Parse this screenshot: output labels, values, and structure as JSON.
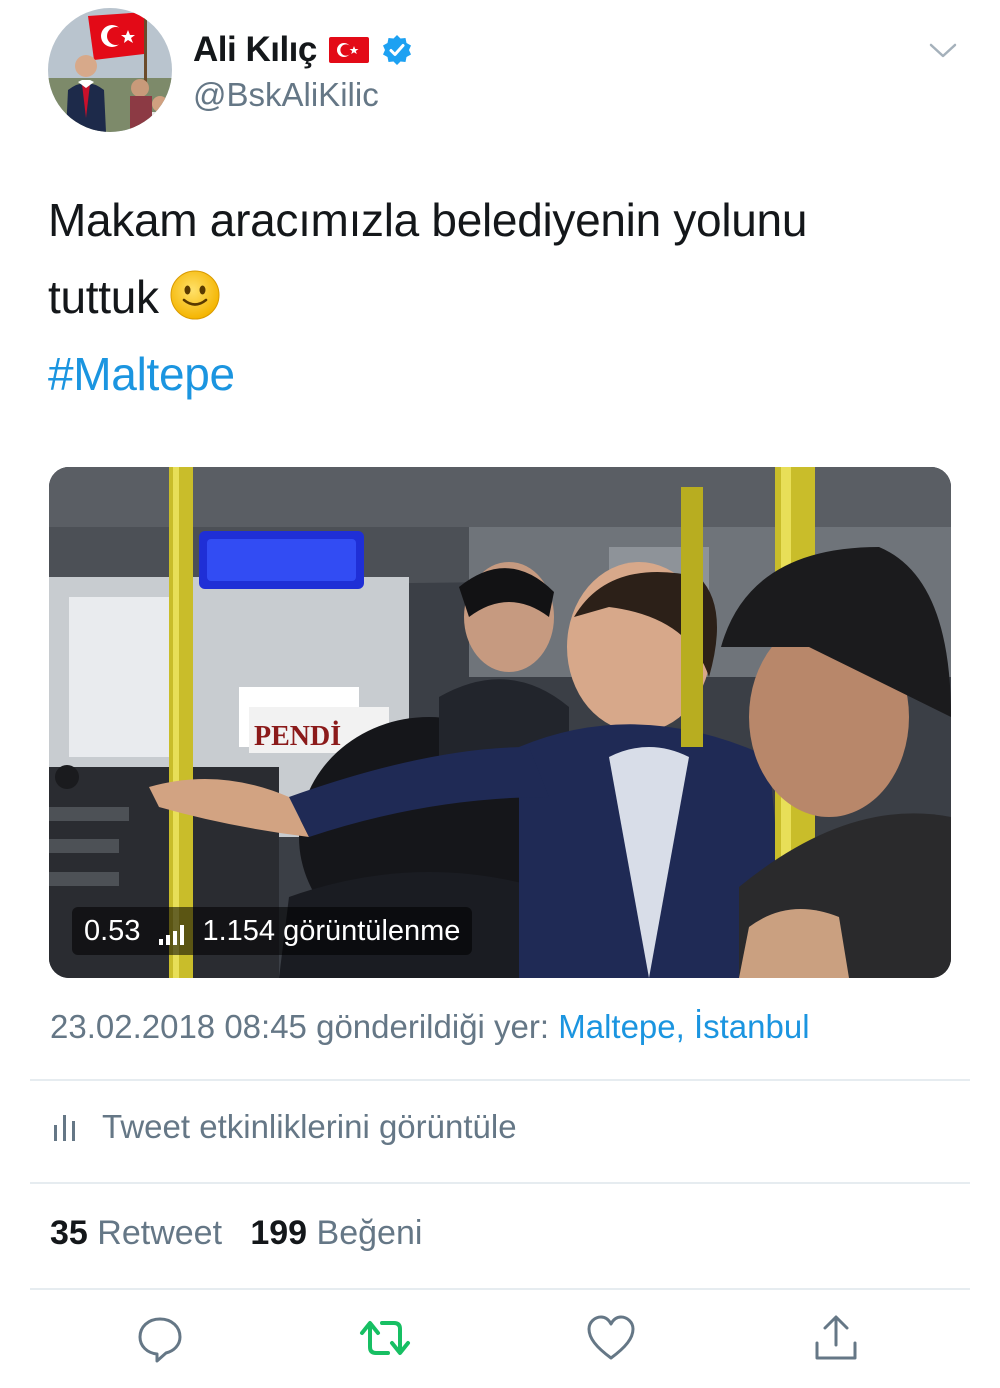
{
  "user": {
    "display_name": "Ali Kılıç",
    "handle": "@BskAliKilic",
    "verified": true
  },
  "tweet": {
    "line1": "Makam aracımızla belediyenin yolunu",
    "line2": "tuttuk",
    "emoji": "slightly-smiling-face-icon",
    "hashtag": "#Maltepe"
  },
  "video": {
    "duration": "0.53",
    "views": "1.154 görüntülenme",
    "sign_text": "PENDİ"
  },
  "meta": {
    "timestamp": "23.02.2018 08:45",
    "location_prefix": "gönderildiği yer:",
    "location": "Maltepe, İstanbul"
  },
  "activity": {
    "label": "Tweet etkinliklerini görüntüle"
  },
  "stats": {
    "retweets": "35",
    "retweet_label": "Retweet",
    "likes": "199",
    "like_label": "Beğeni"
  },
  "colors": {
    "link": "#1b95e0",
    "muted": "#657786",
    "retweet_green": "#17bf63",
    "text": "#14171a"
  }
}
